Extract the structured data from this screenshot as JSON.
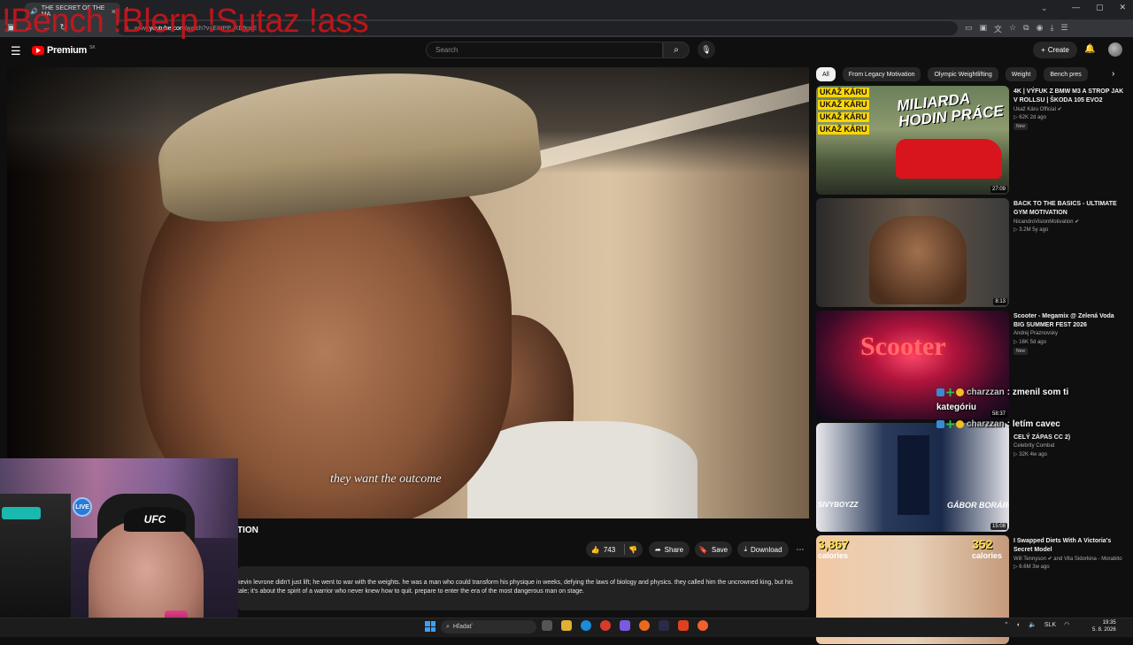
{
  "browser": {
    "tab_title": "THE SECRET OF THE MA",
    "url_host": "youtube.com",
    "url_prefix": "www.",
    "url_rest": "/watch?v=EiHPP_KE9osE",
    "close_glyph": "×",
    "new_tab_glyph": "+"
  },
  "overlay": {
    "commands": "!Bench !Blerp !Sutaz !ass"
  },
  "youtube": {
    "logo_text": "Premium",
    "logo_region": "SK",
    "search_placeholder": "Search",
    "create_label": "Create",
    "video": {
      "subtitle": "they want the outcome",
      "title_visible": "TION",
      "likes": "743",
      "share_label": "Share",
      "save_label": "Save",
      "download_label": "Download",
      "description": "kevin levrone didn't just lift; he went to war with the weights. he was a man who could transform his physique in weeks, defying the laws of biology and physics. they called him the uncrowned king, but his tale; it's about the spirit of a warrior who never knew how to quit. prepare to enter the era of the most dangerous man on stage."
    },
    "chips": [
      "All",
      "From Legacy Motivation",
      "Olympic Weightlifting",
      "Weight",
      "Bench pres"
    ],
    "recommendations": [
      {
        "title": "4K | VÝFUK Z BMW M3 A STROP JAK V ROLLSU | ŠKODA 105 EVO2",
        "channel": "Ukaž Káru Official",
        "meta": "62K  2d ago",
        "badge": "New",
        "duration": "27:09",
        "thumb_brand": "UKAŽ KÁRU",
        "thumb_text_1": "MILIARDA",
        "thumb_text_2": "HODIN PRÁCE"
      },
      {
        "title": "BACK TO THE BASICS - ULTIMATE GYM MOTIVATION",
        "channel": "NicandroVisionMotivation",
        "meta": "3.2M  5y ago",
        "duration": "8:13"
      },
      {
        "title": "Scooter - Megamix @ Zelená Voda BIG SUMMER FEST 2026",
        "channel": "Andrej Praznovsky",
        "meta": "16K  5d ago",
        "badge": "New",
        "duration": "58:37",
        "thumb_text": "Scooter"
      },
      {
        "title": "CELÝ ZÁPAS CC 2)",
        "channel": "Celebrity Combat",
        "meta": "32K  4w ago",
        "duration": "15:08",
        "thumb_left": "SIVYBOYZZ",
        "thumb_right": "GÁBOR BORÁROS"
      },
      {
        "title": "I Swapped Diets With A Victoria's Secret Model",
        "channel": "Will Tennyson",
        "channel_extra": "and Vita Sidorkina - Morabito",
        "meta": "6.6M  3w ago",
        "thumb_num_1": "3,867",
        "thumb_num_2": "352",
        "thumb_unit": "calories"
      }
    ]
  },
  "chat": [
    {
      "user": "charzzan",
      "text": ": zmenil som ti",
      "cont": "kategóriu"
    },
    {
      "user": "charzzan",
      "text": ": letím cavec"
    }
  ],
  "webcam": {
    "cap_text": "UFC",
    "live_badge": "LIVE"
  },
  "taskbar": {
    "search_placeholder": "Hľadať",
    "lang": "SLK",
    "time": "19:35",
    "date": "5. 8. 2026"
  },
  "colors": {
    "yt_red": "#ff0000",
    "overlay_red": "#d0141c",
    "bg": "#0f0f0f"
  }
}
